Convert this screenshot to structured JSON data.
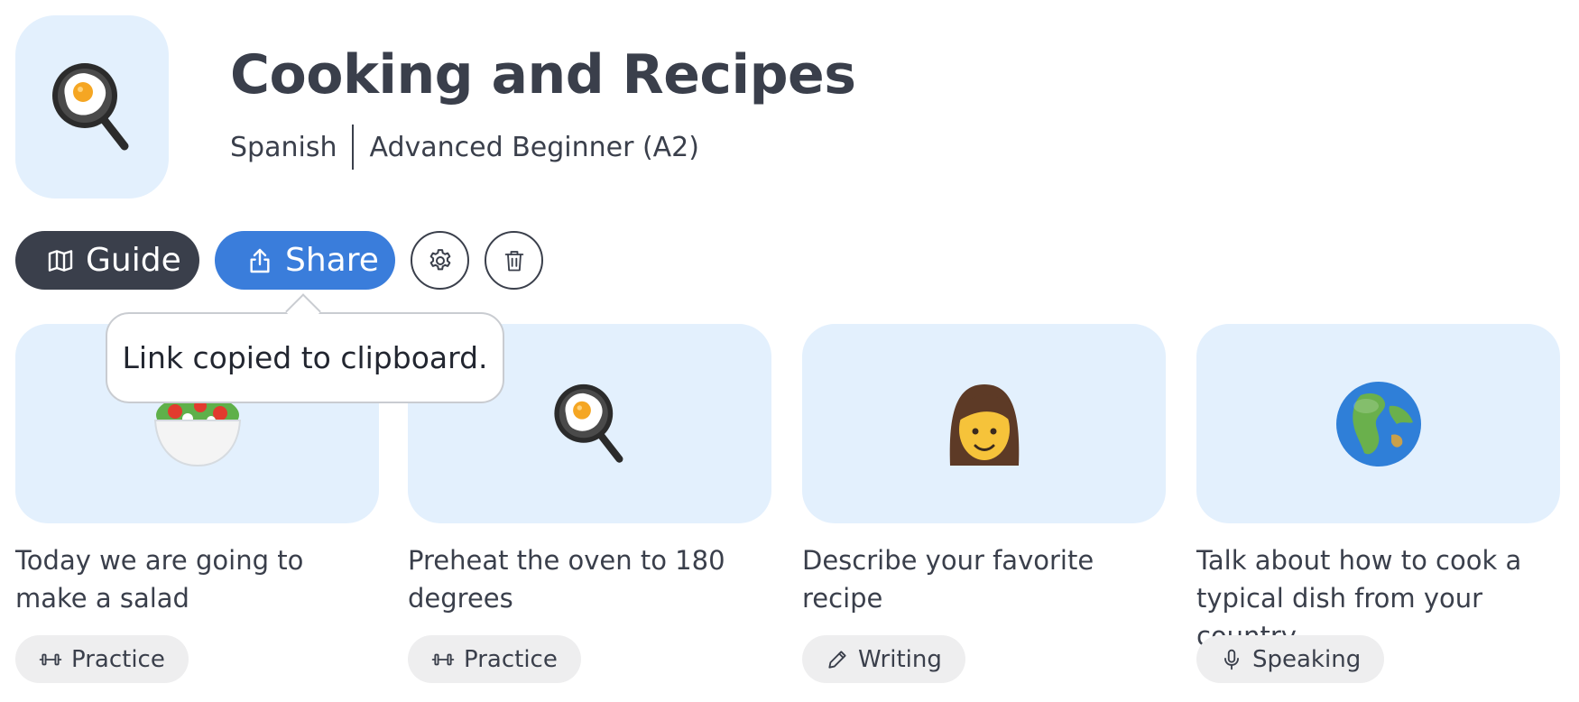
{
  "header": {
    "title": "Cooking and Recipes",
    "language": "Spanish",
    "level": "Advanced Beginner (A2)",
    "icon": "frying-pan-egg-icon",
    "tile_color": "#e3f0fd"
  },
  "actions": {
    "guide_label": "Guide",
    "guide_icon": "map-icon",
    "share_label": "Share",
    "share_icon": "share-icon",
    "settings_icon": "gear-icon",
    "delete_icon": "trash-icon",
    "guide_color": "#3a3f4b",
    "share_color": "#3a7ddb"
  },
  "tooltip": {
    "text": "Link copied to clipboard."
  },
  "cards": [
    {
      "title": "Today we are going to make a salad",
      "icon": "salad-bowl-icon",
      "tag_label": "Practice",
      "tag_icon": "dumbbell-icon"
    },
    {
      "title": "Preheat the oven to 180 degrees",
      "icon": "frying-pan-egg-icon",
      "tag_label": "Practice",
      "tag_icon": "dumbbell-icon"
    },
    {
      "title": "Describe your favorite recipe",
      "icon": "woman-icon",
      "tag_label": "Writing",
      "tag_icon": "pencil-icon"
    },
    {
      "title": "Talk about how to cook a typical dish from your country",
      "icon": "globe-icon",
      "tag_label": "Speaking",
      "tag_icon": "microphone-icon"
    }
  ]
}
